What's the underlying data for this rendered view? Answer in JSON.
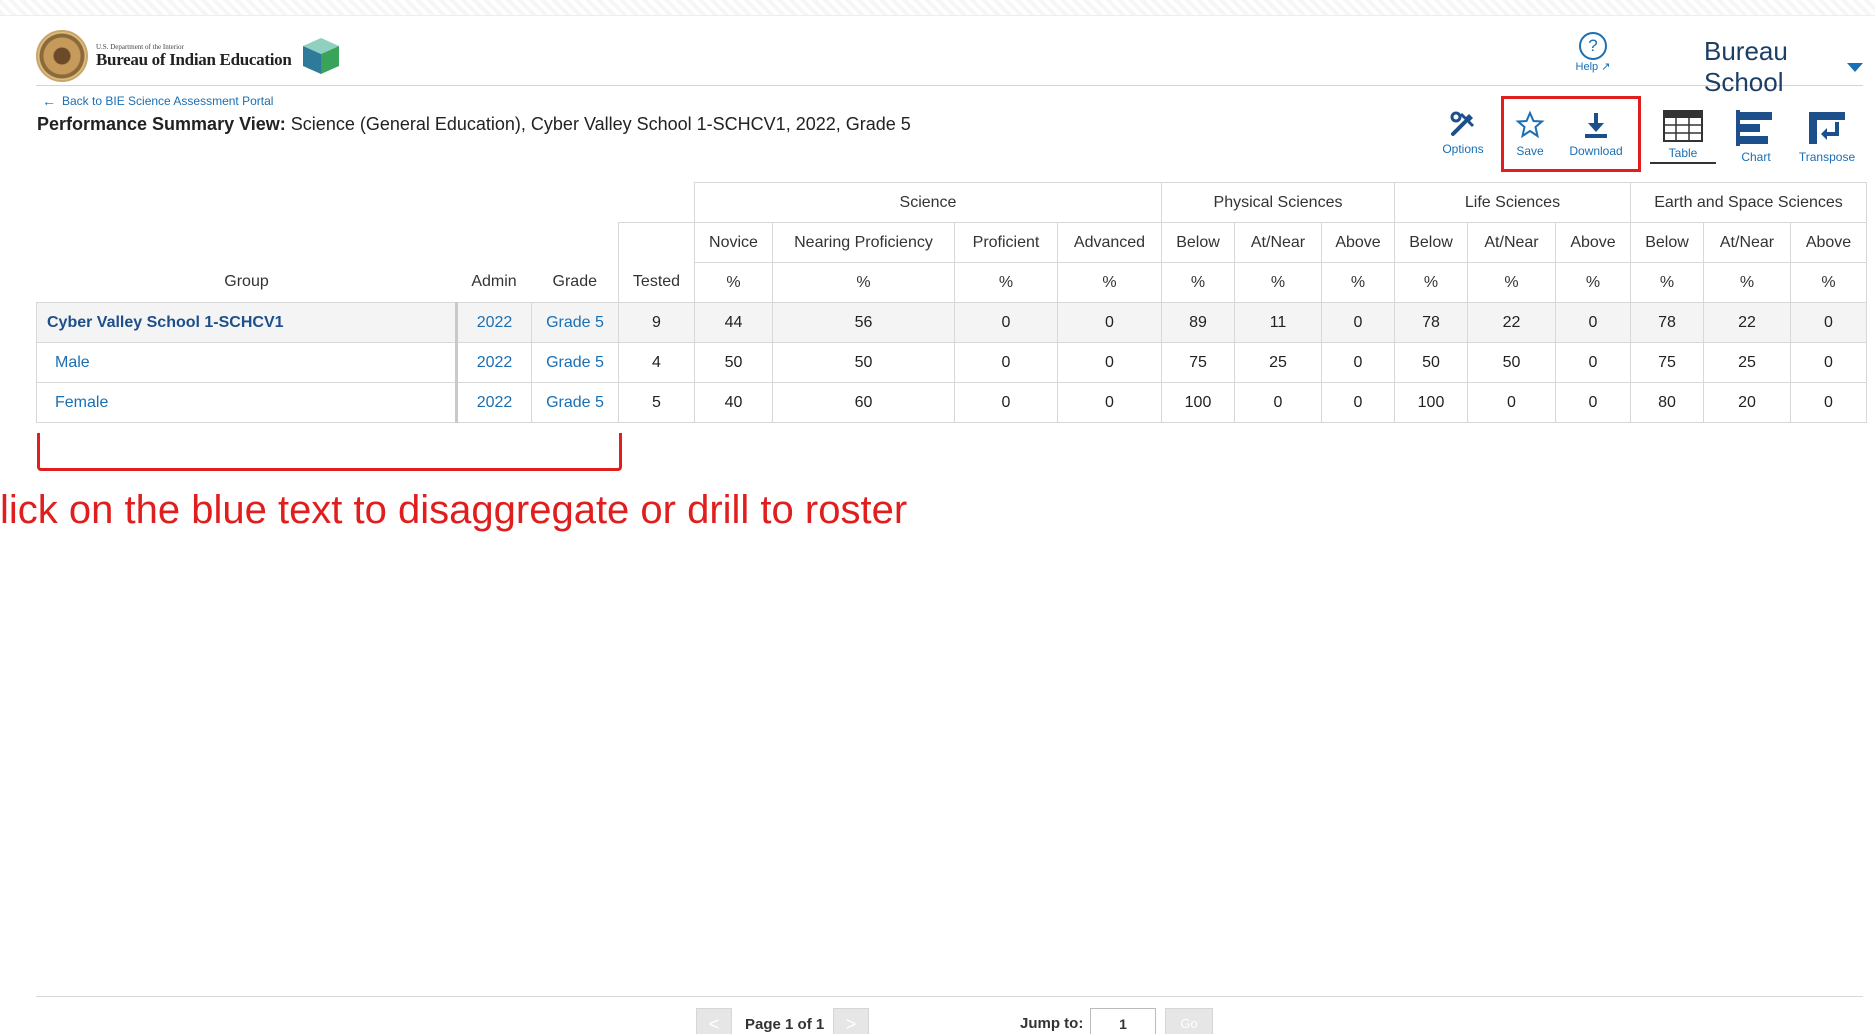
{
  "header": {
    "logo_small": "U.S. Department of the Interior",
    "logo_big": "Bureau of Indian Education",
    "help_label": "Help",
    "user_menu": "Bureau School"
  },
  "subheader": {
    "back_link": "Back to BIE Science Assessment Portal",
    "view_label": "Performance Summary View:",
    "view_value": "Science (General Education), Cyber Valley School 1-SCHCV1, 2022, Grade 5"
  },
  "toolbar": {
    "options": "Options",
    "save": "Save",
    "download": "Download",
    "table": "Table",
    "chart": "Chart",
    "transpose": "Transpose"
  },
  "table": {
    "group_headers": [
      "Science",
      "Physical Sciences",
      "Life Sciences",
      "Earth and Space Sciences"
    ],
    "sub_headers": [
      "Novice",
      "Nearing Proficiency",
      "Proficient",
      "Advanced",
      "Below",
      "At/Near",
      "Above",
      "Below",
      "At/Near",
      "Above",
      "Below",
      "At/Near",
      "Above"
    ],
    "col_headers": [
      "Group",
      "Admin",
      "Grade",
      "Tested"
    ],
    "unit": "%",
    "rows": [
      {
        "group": "Cyber Valley School 1-SCHCV1",
        "admin": "2022",
        "grade": "Grade 5",
        "tested": "9",
        "values": [
          "44",
          "56",
          "0",
          "0",
          "89",
          "11",
          "0",
          "78",
          "22",
          "0",
          "78",
          "22",
          "0"
        ]
      },
      {
        "group": "Male",
        "admin": "2022",
        "grade": "Grade 5",
        "tested": "4",
        "values": [
          "50",
          "50",
          "0",
          "0",
          "75",
          "25",
          "0",
          "50",
          "50",
          "0",
          "75",
          "25",
          "0"
        ]
      },
      {
        "group": "Female",
        "admin": "2022",
        "grade": "Grade 5",
        "tested": "5",
        "values": [
          "40",
          "60",
          "0",
          "0",
          "100",
          "0",
          "0",
          "100",
          "0",
          "0",
          "80",
          "20",
          "0"
        ]
      }
    ]
  },
  "annotation": {
    "text": "lick on the blue text to disaggregate or drill to roster"
  },
  "pager": {
    "page_label": "Page 1 of 1",
    "prev": "<",
    "next": ">",
    "jump_label": "Jump to:",
    "jump_value": "1",
    "go": "Go"
  },
  "colors": {
    "accent": "#1a6fb5",
    "annotation_red": "#e01e1e"
  },
  "icons": [
    "help-icon",
    "options-icon",
    "star-icon",
    "download-icon",
    "table-icon",
    "chart-icon",
    "transpose-icon",
    "back-arrow-icon",
    "caret-down-icon"
  ]
}
